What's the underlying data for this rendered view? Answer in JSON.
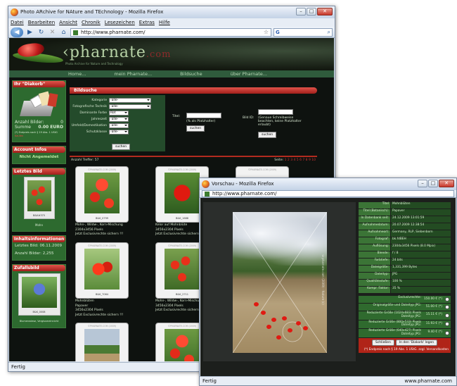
{
  "main_window": {
    "title": "Photo ARchive for NAture and TEchnology - Mozilla Firefox",
    "menu": [
      "Datei",
      "Bearbeiten",
      "Ansicht",
      "Chronik",
      "Lesezeichen",
      "Extras",
      "Hilfe"
    ],
    "url": "http://www.pharnate.com/",
    "status": "Fertig"
  },
  "site": {
    "logo": "pharnate",
    "logo_suffix": ".com",
    "logo_sub": "Photo Archive for Nature and Technology",
    "nav": [
      "Home...",
      "mein Pharnate...",
      "Bildsuche",
      "über Pharnate..."
    ]
  },
  "sidebar": {
    "diakorb_title": "Ihr \"Diakorb\"",
    "anzahl_label": "Anzahl Bilder:",
    "anzahl_value": "0",
    "summe_label": "Summe",
    "summe_value": "0.00 EURO",
    "summe_note": "(*) Endpreis nach § 19 Abs. 1 UStG",
    "kaufen": "Kaufen",
    "account_title": "Account Infos",
    "account_text": "Nicht Angemeldet",
    "letztes_title": "Letztes Bild",
    "letztes_id": "B&K#375",
    "letztes_cap": "Mohn",
    "info_title": "Inhaltsinformationen",
    "letztes_bild_label": "Letztes Bild:",
    "letztes_bild_date": "06.11.2009",
    "anzahl_bilder_label": "Anzahl Bilder:",
    "anzahl_bilder_value": "2,255",
    "zufall_title": "Zufallsbild",
    "zufall_id": "B&K_0008",
    "zufall_cap": "Blumenwiese, Vergissmeinnicht"
  },
  "search": {
    "title": "Bildsuche",
    "fields": [
      {
        "label": "Kategorie",
        "value": "-alle-"
      },
      {
        "label": "Fotografische Technik",
        "value": "-alle-"
      },
      {
        "label": "Dominante Farbe",
        "value": "Rot"
      },
      {
        "label": "Jahreszeit",
        "value": "-alle-"
      },
      {
        "label": "Umfeld/Domestikation",
        "value": "-alle-"
      },
      {
        "label": "Schutzklasse",
        "value": "-alle-"
      }
    ],
    "submit": "suchen",
    "titel_label": "Titel:",
    "titel_hint": "(% als Platzhalter)",
    "titel_submit": "suchen",
    "bildid_label": "Bild ID:",
    "bildid_hint": "(Genaue Schreibweise beachten, keine Platzhalter erlaubt)",
    "bildid_submit": "suchen",
    "treffer": "Anzahl Treffer: 57",
    "pages_label": "Seite:",
    "pages": "1 2 3 4 5 6 7 8 9 10"
  },
  "tiles": [
    {
      "id": "B&K_0799",
      "wm": "©PHARNATE.COM (2009)",
      "lines": [
        "Mohn-, Wildw-, Korn-Mischung",
        "2304x3456 Pixels",
        "Jetzt Exclusivrechte sichern !!!"
      ]
    },
    {
      "id": "B&K_1688",
      "wm": "©PHARNATE.COM (2009)",
      "lines": [
        "Kelor auf Mohnblüte",
        "3456x2304 Pixels",
        "Jetzt Exclusivrechte sichern !!!"
      ]
    },
    {
      "id": "B&K_7064",
      "wm": "©PHARNATE.COM (2009)",
      "lines": [
        "Mohnblüten",
        "Papaver",
        "3456x2304 Pixels",
        "Jetzt Exclusivrechte sichern !!!"
      ]
    },
    {
      "id": "B&K_2711",
      "wm": "©PHARNATE.COM (2009)",
      "lines": [
        "Mohn-, Wildw-, Korn-Mischung",
        "3456x2304 Pixels",
        "Jetzt Exclusivrechte sichern !!!"
      ]
    },
    {
      "id": "",
      "wm": "©PHARNATE.COM (2009)",
      "lines": []
    },
    {
      "id": "",
      "wm": "©PHARNATE.COM (2009)",
      "lines": []
    }
  ],
  "preview_window": {
    "title": "Vorschau - Mozilla Firefox",
    "url": "http://www.pharnate.com/",
    "status_left": "Fertig",
    "status_right": "www.pharnate.com",
    "watermark": "©pharnate.com (2009) - Nature (c)"
  },
  "details": [
    {
      "k": "Titel",
      "v": "Mohnblüten"
    },
    {
      "k": "Titel (Botanisch):",
      "v": "Papaver"
    },
    {
      "k": "In Datenbank seit:",
      "v": "24.12.2009 13:01:59"
    },
    {
      "k": "Aufnahmedatum:",
      "v": "20.07.2009 12:38:54"
    },
    {
      "k": "Aufnahmeort:",
      "v": "Germany, RLP, Siebenborn"
    },
    {
      "k": "Fotograf:",
      "v": "bk.fdBEH"
    },
    {
      "k": "Auflösung:",
      "v": "2304x3456 Pixels (8.0 Mpix)"
    },
    {
      "k": "Blende:",
      "v": "f / 8"
    },
    {
      "k": "Farbtiefe:",
      "v": "24 bits"
    },
    {
      "k": "Dateigröße:",
      "v": "1,331,399 Bytes"
    },
    {
      "k": "Dateityp:",
      "v": "JPG"
    },
    {
      "k": "Qualitätsstufe:",
      "v": "100 %"
    },
    {
      "k": "Kompr. Faktor:",
      "v": "35 %"
    }
  ],
  "prices": [
    {
      "k": "Exclusivrechte:",
      "v": "150.00 € (*)"
    },
    {
      "k": "Originalgröße und Dateityp JPG:",
      "v": "51.00 € (*)"
    },
    {
      "k": "Reduzierte Größe (1024x683) Pixels Dateityp JPG:",
      "v": "15.11 € (*)"
    },
    {
      "k": "Reduzierte Größe (800x533) Pixels Dateityp JPG:",
      "v": "11.93 € (*)"
    },
    {
      "k": "Reduzierte Größe (640x427) Pixels Dateityp JPG:",
      "v": "9.40 € (*)"
    }
  ],
  "actions": {
    "close": "Schließen",
    "add": "In den 'Diakorb' legen"
  },
  "price_note": "(*) Endpreis nach § 19 Abs. 1 UStG. zzgl. Versandkosten"
}
